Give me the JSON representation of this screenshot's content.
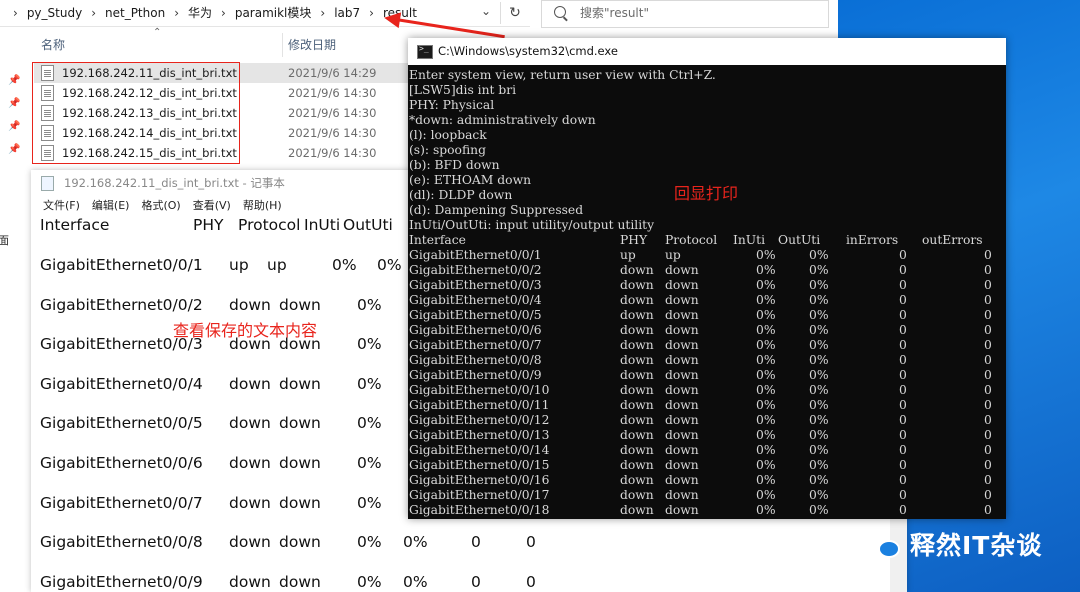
{
  "explorer": {
    "breadcrumbs": [
      "py_Study",
      "net_Pthon",
      "华为",
      "paramikl模块",
      "lab7",
      "result"
    ],
    "search_placeholder": "搜索\"result\"",
    "columns": {
      "name": "名称",
      "date": "修改日期"
    },
    "nav_cut_text": "桌面",
    "files": [
      {
        "name": "192.168.242.11_dis_int_bri.txt",
        "date": "2021/9/6 14:29",
        "selected": true
      },
      {
        "name": "192.168.242.12_dis_int_bri.txt",
        "date": "2021/9/6 14:30",
        "selected": false
      },
      {
        "name": "192.168.242.13_dis_int_bri.txt",
        "date": "2021/9/6 14:30",
        "selected": false
      },
      {
        "name": "192.168.242.14_dis_int_bri.txt",
        "date": "2021/9/6 14:30",
        "selected": false
      },
      {
        "name": "192.168.242.15_dis_int_bri.txt",
        "date": "2021/9/6 14:30",
        "selected": false
      }
    ]
  },
  "notepad": {
    "title": "192.168.242.11_dis_int_bri.txt - 记事本",
    "menu": [
      "文件(F)",
      "编辑(E)",
      "格式(O)",
      "查看(V)",
      "帮助(H)"
    ],
    "header": [
      "Interface",
      "PHY",
      "Protocol",
      "InUti",
      "OutUti"
    ],
    "rows": [
      {
        "iface": "GigabitEthernet0/0/1",
        "phy": "up",
        "proto": "up",
        "inuti": "0%",
        "oututi": "0%",
        "c6": "",
        "c7": ""
      },
      {
        "iface": "GigabitEthernet0/0/2",
        "phy": "down",
        "proto": "down",
        "inuti": "0%",
        "oututi": "",
        "c6": "",
        "c7": ""
      },
      {
        "iface": "GigabitEthernet0/0/3",
        "phy": "down",
        "proto": "down",
        "inuti": "0%",
        "oututi": "",
        "c6": "",
        "c7": ""
      },
      {
        "iface": "GigabitEthernet0/0/4",
        "phy": "down",
        "proto": "down",
        "inuti": "0%",
        "oututi": "",
        "c6": "",
        "c7": ""
      },
      {
        "iface": "GigabitEthernet0/0/5",
        "phy": "down",
        "proto": "down",
        "inuti": "0%",
        "oututi": "",
        "c6": "",
        "c7": ""
      },
      {
        "iface": "GigabitEthernet0/0/6",
        "phy": "down",
        "proto": "down",
        "inuti": "0%",
        "oututi": "",
        "c6": "",
        "c7": ""
      },
      {
        "iface": "GigabitEthernet0/0/7",
        "phy": "down",
        "proto": "down",
        "inuti": "0%",
        "oututi": "",
        "c6": "",
        "c7": ""
      },
      {
        "iface": "GigabitEthernet0/0/8",
        "phy": "down",
        "proto": "down",
        "inuti": "0%",
        "oututi": "0%",
        "c6": "0",
        "c7": "0"
      },
      {
        "iface": "GigabitEthernet0/0/9",
        "phy": "down",
        "proto": "down",
        "inuti": "0%",
        "oututi": "0%",
        "c6": "0",
        "c7": "0"
      }
    ]
  },
  "cmd": {
    "title": "C:\\Windows\\system32\\cmd.exe",
    "lines": [
      "Enter system view, return user view with Ctrl+Z.",
      "[LSW5]dis int bri",
      "PHY: Physical",
      "*down: administratively down",
      "(l): loopback",
      "(s): spoofing",
      "(b): BFD down",
      "(e): ETHOAM down",
      "(dl): DLDP down",
      "(d): Dampening Suppressed",
      "InUti/OutUti: input utility/output utility"
    ],
    "table_header": [
      "Interface",
      "PHY",
      "Protocol",
      "InUti",
      "OutUti",
      "inErrors",
      "outErrors"
    ],
    "table_rows": [
      [
        "GigabitEthernet0/0/1",
        "up",
        "up",
        "0%",
        "0%",
        "0",
        "0"
      ],
      [
        "GigabitEthernet0/0/2",
        "down",
        "down",
        "0%",
        "0%",
        "0",
        "0"
      ],
      [
        "GigabitEthernet0/0/3",
        "down",
        "down",
        "0%",
        "0%",
        "0",
        "0"
      ],
      [
        "GigabitEthernet0/0/4",
        "down",
        "down",
        "0%",
        "0%",
        "0",
        "0"
      ],
      [
        "GigabitEthernet0/0/5",
        "down",
        "down",
        "0%",
        "0%",
        "0",
        "0"
      ],
      [
        "GigabitEthernet0/0/6",
        "down",
        "down",
        "0%",
        "0%",
        "0",
        "0"
      ],
      [
        "GigabitEthernet0/0/7",
        "down",
        "down",
        "0%",
        "0%",
        "0",
        "0"
      ],
      [
        "GigabitEthernet0/0/8",
        "down",
        "down",
        "0%",
        "0%",
        "0",
        "0"
      ],
      [
        "GigabitEthernet0/0/9",
        "down",
        "down",
        "0%",
        "0%",
        "0",
        "0"
      ],
      [
        "GigabitEthernet0/0/10",
        "down",
        "down",
        "0%",
        "0%",
        "0",
        "0"
      ],
      [
        "GigabitEthernet0/0/11",
        "down",
        "down",
        "0%",
        "0%",
        "0",
        "0"
      ],
      [
        "GigabitEthernet0/0/12",
        "down",
        "down",
        "0%",
        "0%",
        "0",
        "0"
      ],
      [
        "GigabitEthernet0/0/13",
        "down",
        "down",
        "0%",
        "0%",
        "0",
        "0"
      ],
      [
        "GigabitEthernet0/0/14",
        "down",
        "down",
        "0%",
        "0%",
        "0",
        "0"
      ],
      [
        "GigabitEthernet0/0/15",
        "down",
        "down",
        "0%",
        "0%",
        "0",
        "0"
      ],
      [
        "GigabitEthernet0/0/16",
        "down",
        "down",
        "0%",
        "0%",
        "0",
        "0"
      ],
      [
        "GigabitEthernet0/0/17",
        "down",
        "down",
        "0%",
        "0%",
        "0",
        "0"
      ],
      [
        "GigabitEthernet0/0/18",
        "down",
        "down",
        "0%",
        "0%",
        "0",
        "0"
      ]
    ]
  },
  "annotations": {
    "notepad_label": "查看保存的文本内容",
    "cmd_label": "回显打印",
    "color": "#e8241c"
  },
  "brand": {
    "text": "释然IT杂谈"
  }
}
